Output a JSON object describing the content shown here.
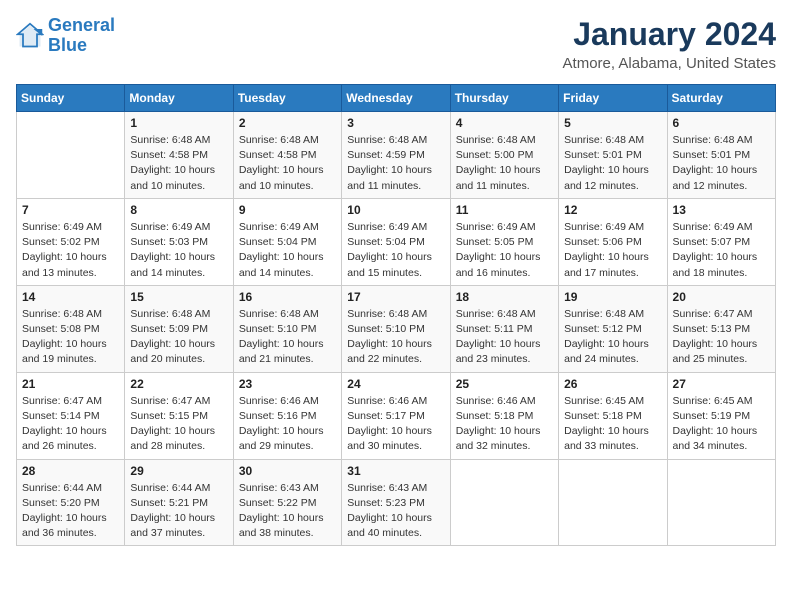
{
  "header": {
    "logo_line1": "General",
    "logo_line2": "Blue",
    "title": "January 2024",
    "subtitle": "Atmore, Alabama, United States"
  },
  "columns": [
    "Sunday",
    "Monday",
    "Tuesday",
    "Wednesday",
    "Thursday",
    "Friday",
    "Saturday"
  ],
  "weeks": [
    [
      {
        "day": "",
        "info": ""
      },
      {
        "day": "1",
        "info": "Sunrise: 6:48 AM\nSunset: 4:58 PM\nDaylight: 10 hours\nand 10 minutes."
      },
      {
        "day": "2",
        "info": "Sunrise: 6:48 AM\nSunset: 4:58 PM\nDaylight: 10 hours\nand 10 minutes."
      },
      {
        "day": "3",
        "info": "Sunrise: 6:48 AM\nSunset: 4:59 PM\nDaylight: 10 hours\nand 11 minutes."
      },
      {
        "day": "4",
        "info": "Sunrise: 6:48 AM\nSunset: 5:00 PM\nDaylight: 10 hours\nand 11 minutes."
      },
      {
        "day": "5",
        "info": "Sunrise: 6:48 AM\nSunset: 5:01 PM\nDaylight: 10 hours\nand 12 minutes."
      },
      {
        "day": "6",
        "info": "Sunrise: 6:48 AM\nSunset: 5:01 PM\nDaylight: 10 hours\nand 12 minutes."
      }
    ],
    [
      {
        "day": "7",
        "info": "Sunrise: 6:49 AM\nSunset: 5:02 PM\nDaylight: 10 hours\nand 13 minutes."
      },
      {
        "day": "8",
        "info": "Sunrise: 6:49 AM\nSunset: 5:03 PM\nDaylight: 10 hours\nand 14 minutes."
      },
      {
        "day": "9",
        "info": "Sunrise: 6:49 AM\nSunset: 5:04 PM\nDaylight: 10 hours\nand 14 minutes."
      },
      {
        "day": "10",
        "info": "Sunrise: 6:49 AM\nSunset: 5:04 PM\nDaylight: 10 hours\nand 15 minutes."
      },
      {
        "day": "11",
        "info": "Sunrise: 6:49 AM\nSunset: 5:05 PM\nDaylight: 10 hours\nand 16 minutes."
      },
      {
        "day": "12",
        "info": "Sunrise: 6:49 AM\nSunset: 5:06 PM\nDaylight: 10 hours\nand 17 minutes."
      },
      {
        "day": "13",
        "info": "Sunrise: 6:49 AM\nSunset: 5:07 PM\nDaylight: 10 hours\nand 18 minutes."
      }
    ],
    [
      {
        "day": "14",
        "info": "Sunrise: 6:48 AM\nSunset: 5:08 PM\nDaylight: 10 hours\nand 19 minutes."
      },
      {
        "day": "15",
        "info": "Sunrise: 6:48 AM\nSunset: 5:09 PM\nDaylight: 10 hours\nand 20 minutes."
      },
      {
        "day": "16",
        "info": "Sunrise: 6:48 AM\nSunset: 5:10 PM\nDaylight: 10 hours\nand 21 minutes."
      },
      {
        "day": "17",
        "info": "Sunrise: 6:48 AM\nSunset: 5:10 PM\nDaylight: 10 hours\nand 22 minutes."
      },
      {
        "day": "18",
        "info": "Sunrise: 6:48 AM\nSunset: 5:11 PM\nDaylight: 10 hours\nand 23 minutes."
      },
      {
        "day": "19",
        "info": "Sunrise: 6:48 AM\nSunset: 5:12 PM\nDaylight: 10 hours\nand 24 minutes."
      },
      {
        "day": "20",
        "info": "Sunrise: 6:47 AM\nSunset: 5:13 PM\nDaylight: 10 hours\nand 25 minutes."
      }
    ],
    [
      {
        "day": "21",
        "info": "Sunrise: 6:47 AM\nSunset: 5:14 PM\nDaylight: 10 hours\nand 26 minutes."
      },
      {
        "day": "22",
        "info": "Sunrise: 6:47 AM\nSunset: 5:15 PM\nDaylight: 10 hours\nand 28 minutes."
      },
      {
        "day": "23",
        "info": "Sunrise: 6:46 AM\nSunset: 5:16 PM\nDaylight: 10 hours\nand 29 minutes."
      },
      {
        "day": "24",
        "info": "Sunrise: 6:46 AM\nSunset: 5:17 PM\nDaylight: 10 hours\nand 30 minutes."
      },
      {
        "day": "25",
        "info": "Sunrise: 6:46 AM\nSunset: 5:18 PM\nDaylight: 10 hours\nand 32 minutes."
      },
      {
        "day": "26",
        "info": "Sunrise: 6:45 AM\nSunset: 5:18 PM\nDaylight: 10 hours\nand 33 minutes."
      },
      {
        "day": "27",
        "info": "Sunrise: 6:45 AM\nSunset: 5:19 PM\nDaylight: 10 hours\nand 34 minutes."
      }
    ],
    [
      {
        "day": "28",
        "info": "Sunrise: 6:44 AM\nSunset: 5:20 PM\nDaylight: 10 hours\nand 36 minutes."
      },
      {
        "day": "29",
        "info": "Sunrise: 6:44 AM\nSunset: 5:21 PM\nDaylight: 10 hours\nand 37 minutes."
      },
      {
        "day": "30",
        "info": "Sunrise: 6:43 AM\nSunset: 5:22 PM\nDaylight: 10 hours\nand 38 minutes."
      },
      {
        "day": "31",
        "info": "Sunrise: 6:43 AM\nSunset: 5:23 PM\nDaylight: 10 hours\nand 40 minutes."
      },
      {
        "day": "",
        "info": ""
      },
      {
        "day": "",
        "info": ""
      },
      {
        "day": "",
        "info": ""
      }
    ]
  ]
}
